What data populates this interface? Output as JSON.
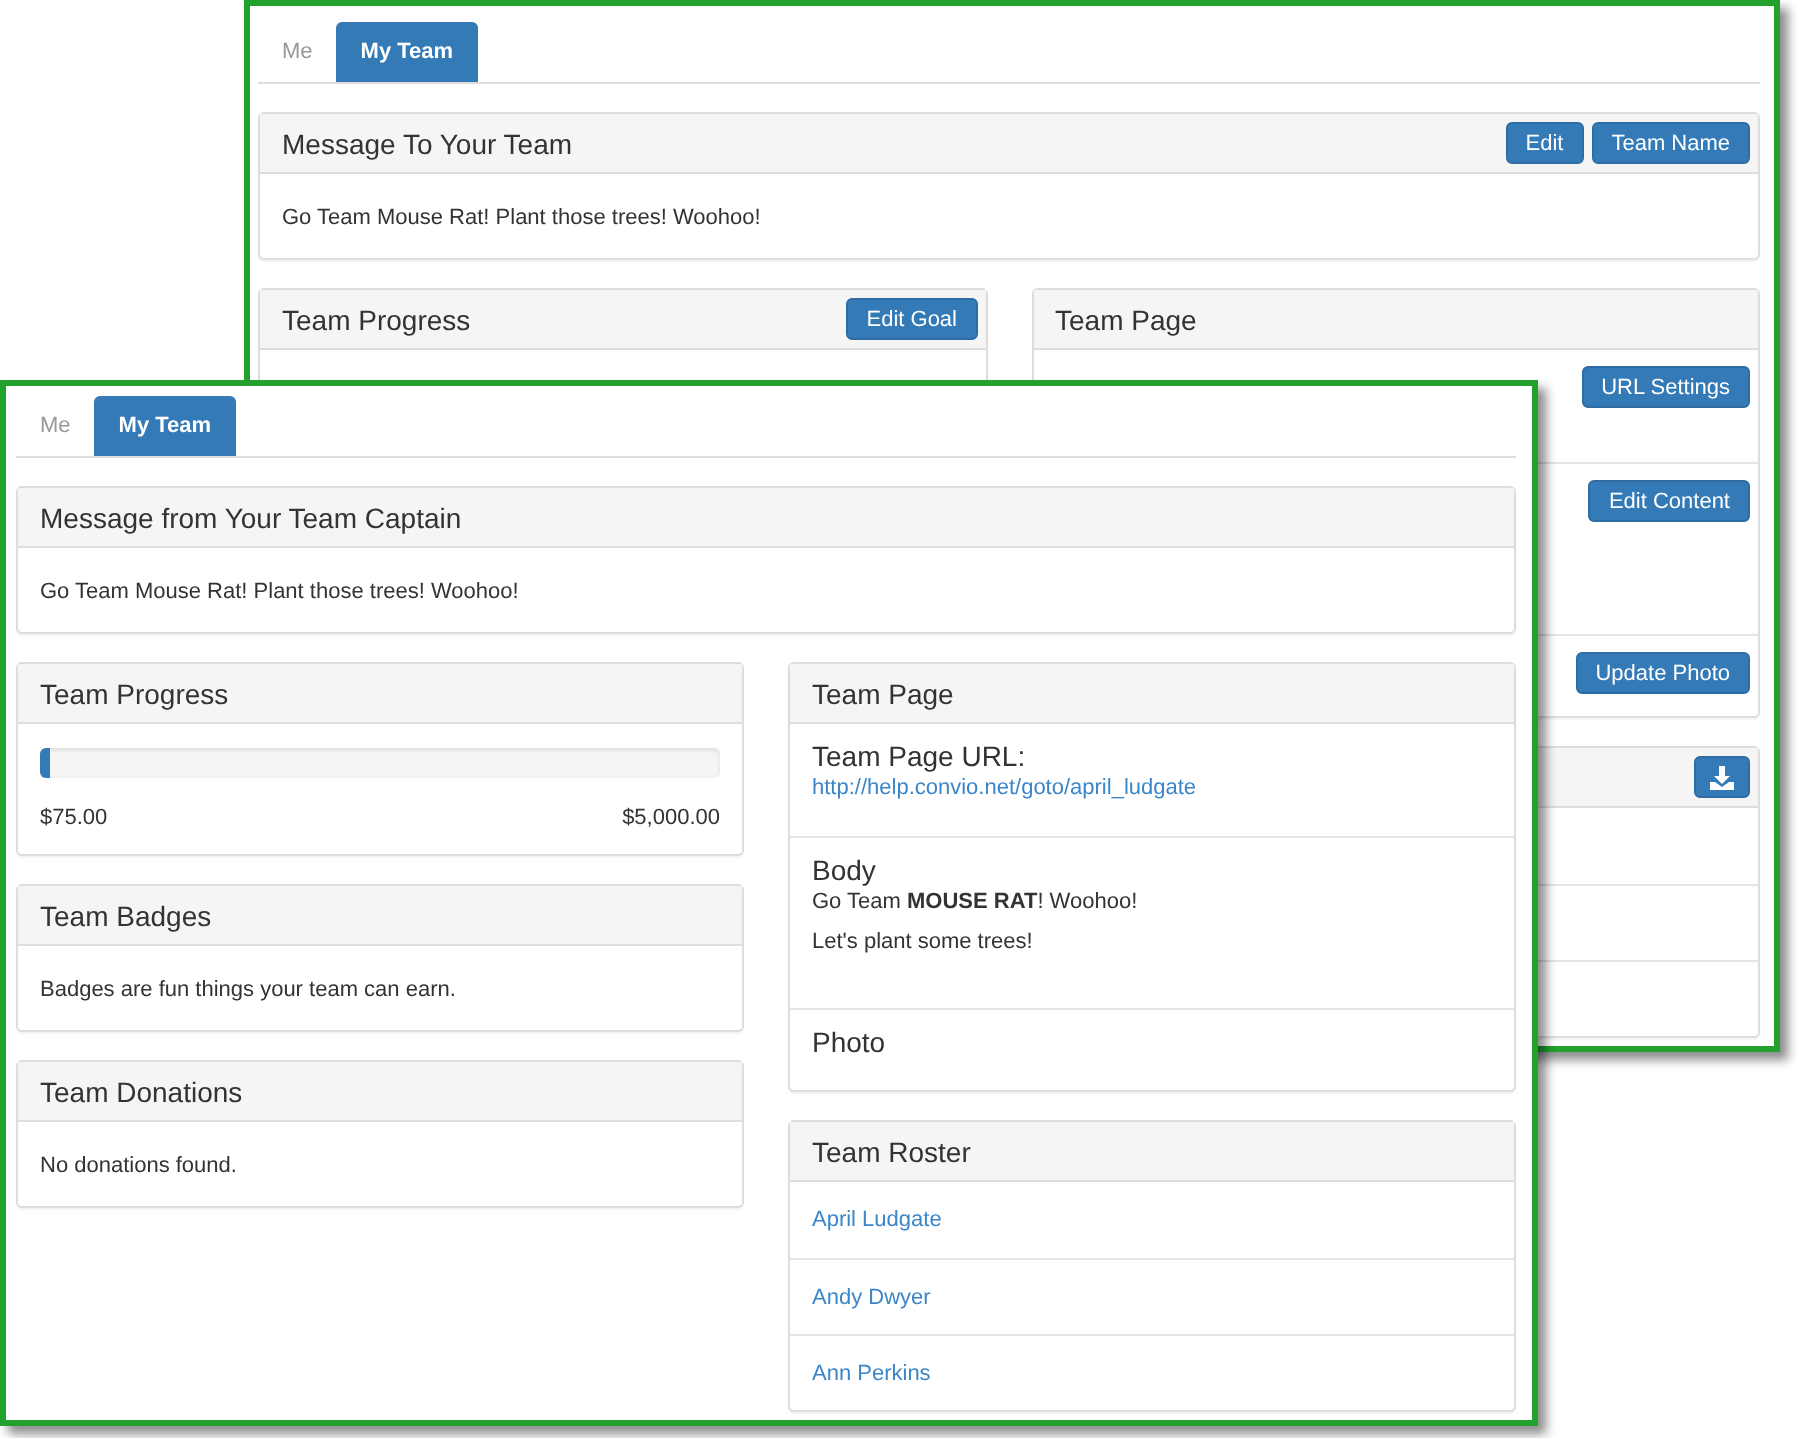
{
  "windows": [
    {
      "tabs": [
        {
          "label": "Me",
          "selected": false
        },
        {
          "label": "My Team",
          "selected": true
        }
      ],
      "message_panel": {
        "title": "Message To Your Team",
        "buttons": [
          "Edit",
          "Team Name"
        ],
        "text": "Go Team Mouse Rat! Plant those trees! Woohoo!"
      },
      "columns": [
        {
          "panels": [
            {
              "title": "Team Progress",
              "buttons": [
                "Edit Goal"
              ]
            }
          ]
        },
        {
          "panels": [
            {
              "title": "Team Page",
              "body": {
                "kind": "sections",
                "sections": [
                  {
                    "kind": "url",
                    "button": "URL Settings"
                  },
                  {
                    "kind": "body",
                    "button": "Edit Content"
                  },
                  {
                    "kind": "photo",
                    "button": "Update Photo"
                  }
                ]
              }
            },
            {
              "download_button": true,
              "body": {
                "kind": "links",
                "items": [
                  {
                    "kind": "hidden"
                  },
                  {
                    "kind": "hidden"
                  },
                  {
                    "kind": "hidden"
                  }
                ]
              }
            }
          ]
        }
      ]
    },
    {
      "tabs": [
        {
          "label": "Me",
          "selected": false
        },
        {
          "label": "My Team",
          "selected": true
        }
      ],
      "message_panel": {
        "title": "Message from Your Team Captain",
        "text": "Go Team Mouse Rat! Plant those trees! Woohoo!"
      },
      "columns": [
        {
          "panels": [
            {
              "title": "Team Progress",
              "body": {
                "kind": "progress",
                "level": 0.015,
                "raised": "$75.00",
                "goal": "$5,000.00"
              }
            },
            {
              "title": "Team Badges",
              "body": {
                "kind": "text",
                "text": "Badges are fun things your team can earn."
              }
            },
            {
              "title": "Team Donations",
              "body": {
                "kind": "text",
                "text": "No donations found."
              }
            }
          ]
        },
        {
          "panels": [
            {
              "title": "Team Page",
              "body": {
                "kind": "sections",
                "sections": [
                  {
                    "kind": "url",
                    "heading": "Team Page URL:",
                    "link": "http://help.convio.net/goto/april_ludgate"
                  },
                  {
                    "kind": "body",
                    "heading": "Body",
                    "paragraphs": [
                      "Go Team **MOUSE RAT**! Woohoo!",
                      "Let's plant some trees!"
                    ]
                  },
                  {
                    "kind": "photo",
                    "heading": "Photo"
                  }
                ]
              }
            },
            {
              "title": "Team Roster",
              "body": {
                "kind": "links",
                "items": [
                  {
                    "kind": "link",
                    "label": "April Ludgate"
                  },
                  {
                    "kind": "link",
                    "label": "Andy Dwyer"
                  },
                  {
                    "kind": "link",
                    "label": "Ann Perkins"
                  }
                ]
              }
            }
          ]
        }
      ]
    }
  ]
}
